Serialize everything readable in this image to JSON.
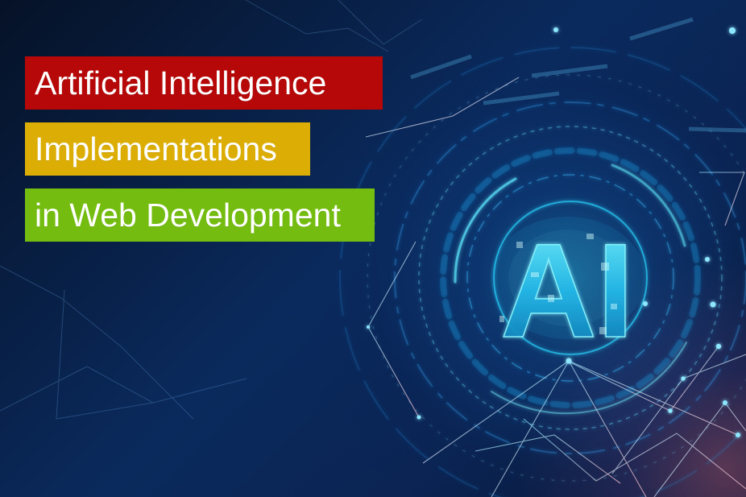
{
  "title_lines": [
    "Artificial Intelligence",
    "Implementations",
    "in Web Development"
  ],
  "center_mark": "AI",
  "colors": {
    "background_dark": "#06173a",
    "background_blue": "#0a2a5d",
    "cyan_glow": "#22d7ff",
    "red_bar": "#b60808",
    "yellow_bar": "#dcae05",
    "green_bar": "#74bd10",
    "pink_glow": "#d96a8c"
  }
}
